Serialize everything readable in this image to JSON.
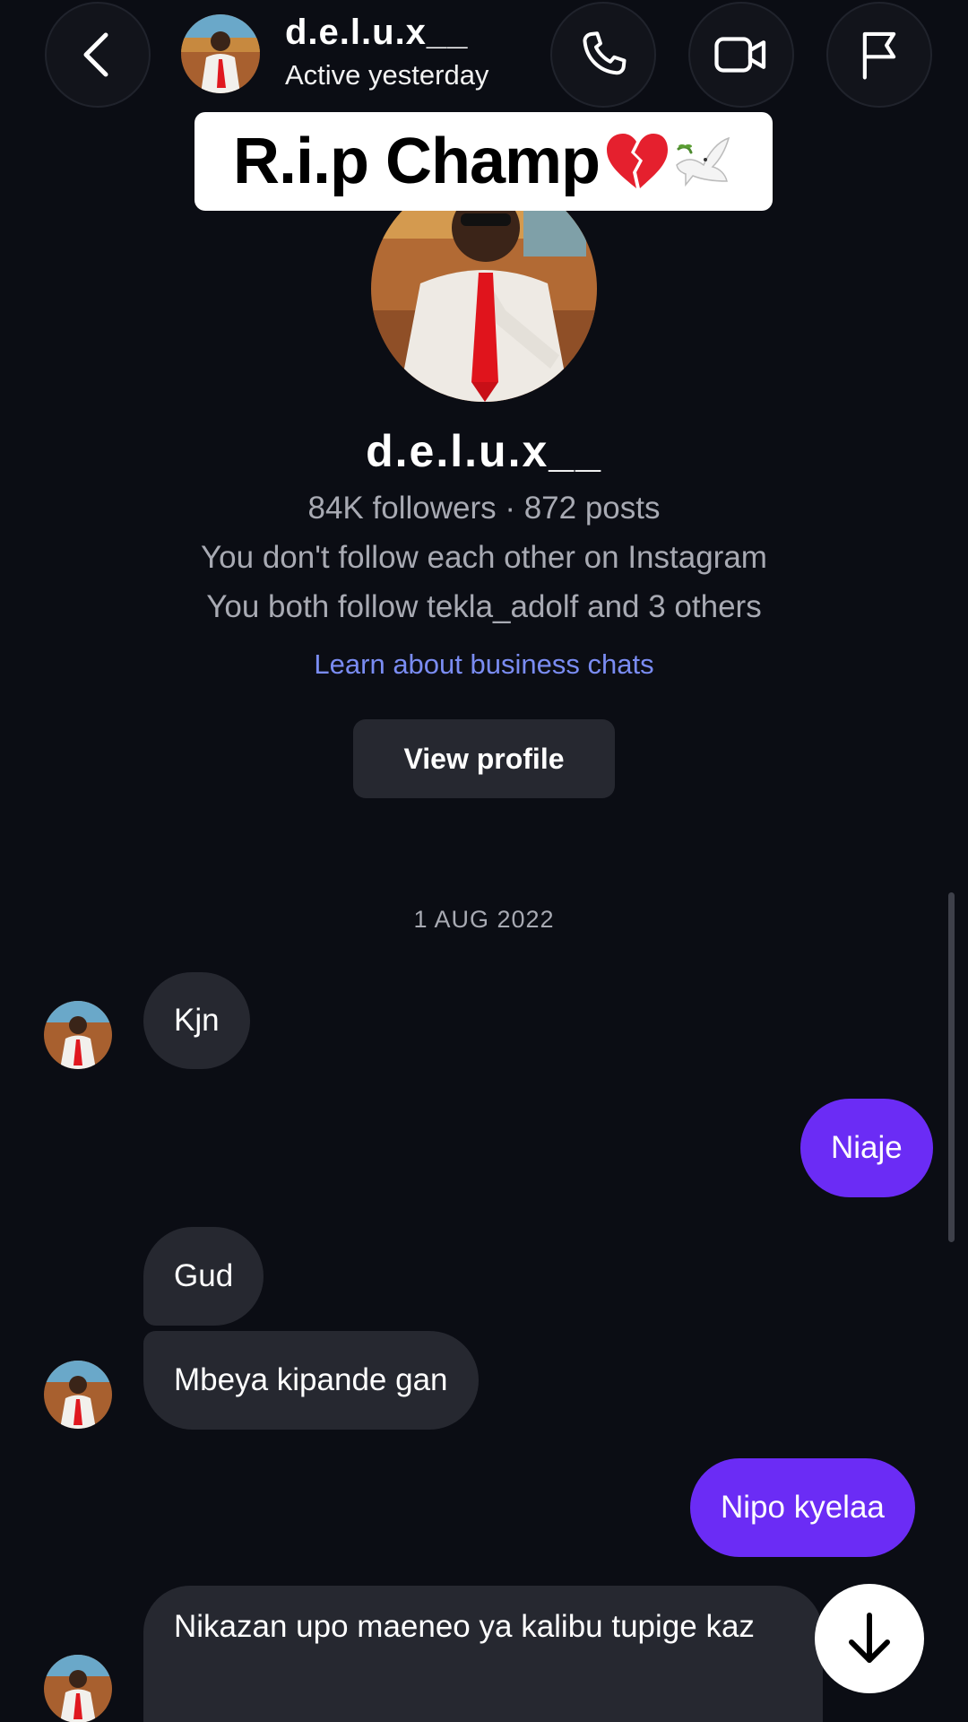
{
  "header": {
    "username": "d.e.l.u.x__",
    "status": "Active yesterday",
    "icons": [
      "back-arrow-icon",
      "phone-icon",
      "video-camera-icon",
      "flag-icon"
    ]
  },
  "overlay": {
    "text": "R.i.p Champ",
    "emoji": [
      "broken-heart-emoji",
      "dove-emoji"
    ]
  },
  "profile": {
    "username": "d.e.l.u.x__",
    "stats": "84K followers · 872 posts",
    "follow_note": "You don't follow each other on Instagram",
    "mutuals": "You both follow tekla_adolf and 3 others",
    "learn_link": "Learn about business chats",
    "view_profile_label": "View profile"
  },
  "thread": {
    "date": "1 AUG 2022",
    "messages": [
      {
        "from": "them",
        "text": "Kjn"
      },
      {
        "from": "me",
        "text": "Niaje"
      },
      {
        "from": "them",
        "text": "Gud"
      },
      {
        "from": "them",
        "text": "Mbeya kipande gan"
      },
      {
        "from": "me",
        "text": "Nipo kyelaa"
      },
      {
        "from": "them",
        "text": "Nikazan upo maeneo ya kalibu tupige kaz"
      }
    ]
  },
  "colors": {
    "background": "#0b0d14",
    "incoming_bubble": "#262830",
    "outgoing_bubble": "#6b2cf5",
    "link": "#7a8cf2",
    "muted_text": "#a8aab3"
  }
}
